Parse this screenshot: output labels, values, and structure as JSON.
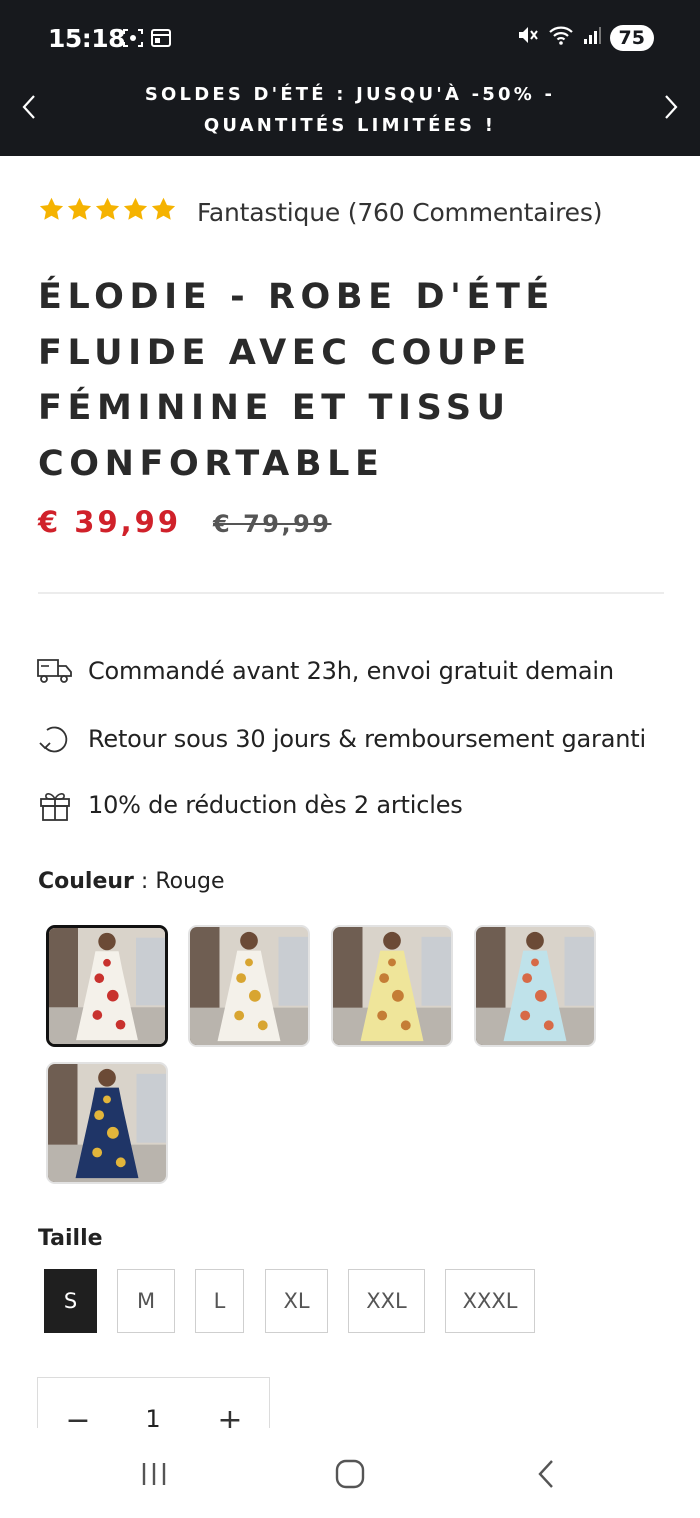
{
  "status_bar": {
    "time": "15:18",
    "battery": "75",
    "icons": [
      "screenshot-icon",
      "calendar-icon",
      "mute-icon",
      "wifi-icon",
      "signal-icon"
    ]
  },
  "announcement": {
    "text": "SOLDES D'ÉTÉ : JUSQU'À -50% - QUANTITÉS LIMITÉES !"
  },
  "rating": {
    "stars": 5,
    "text": "Fantastique (760 Commentaires)",
    "star_color": "#f5b301"
  },
  "product": {
    "title": "ÉLODIE - ROBE D'ÉTÉ FLUIDE AVEC COUPE FÉMININE ET TISSU CONFORTABLE",
    "price": "€ 39,99",
    "old_price": "€ 79,99",
    "price_color": "#d0212a"
  },
  "benefits": [
    {
      "icon": "delivery-truck-icon",
      "text": "Commandé avant 23h, envoi gratuit demain"
    },
    {
      "icon": "return-arrow-icon",
      "text": "Retour sous 30 jours & remboursement garanti"
    },
    {
      "icon": "gift-icon",
      "text": "10% de réduction dès 2 articles"
    }
  ],
  "color": {
    "label": "Couleur",
    "separator": " : ",
    "selected": "Rouge",
    "swatches": [
      {
        "name": "Rouge",
        "dress": "#f4f1ea",
        "accent": "#c8322e",
        "selected": true
      },
      {
        "name": "white-yellow",
        "dress": "#f4f1ea",
        "accent": "#d8a531",
        "selected": false
      },
      {
        "name": "yellow",
        "dress": "#efe59a",
        "accent": "#c47d36",
        "selected": false
      },
      {
        "name": "light-blue",
        "dress": "#bfe2ea",
        "accent": "#d76a47",
        "selected": false
      },
      {
        "name": "navy",
        "dress": "#1f3567",
        "accent": "#e2b53b",
        "selected": false
      }
    ]
  },
  "size": {
    "label": "Taille",
    "options": [
      "S",
      "M",
      "L",
      "XL",
      "XXL",
      "XXXL"
    ],
    "selected": "S"
  },
  "quantity": {
    "value": "1",
    "minus": "−",
    "plus": "+"
  },
  "nav": {
    "icons": [
      "recent-apps-icon",
      "home-icon",
      "back-icon"
    ]
  }
}
